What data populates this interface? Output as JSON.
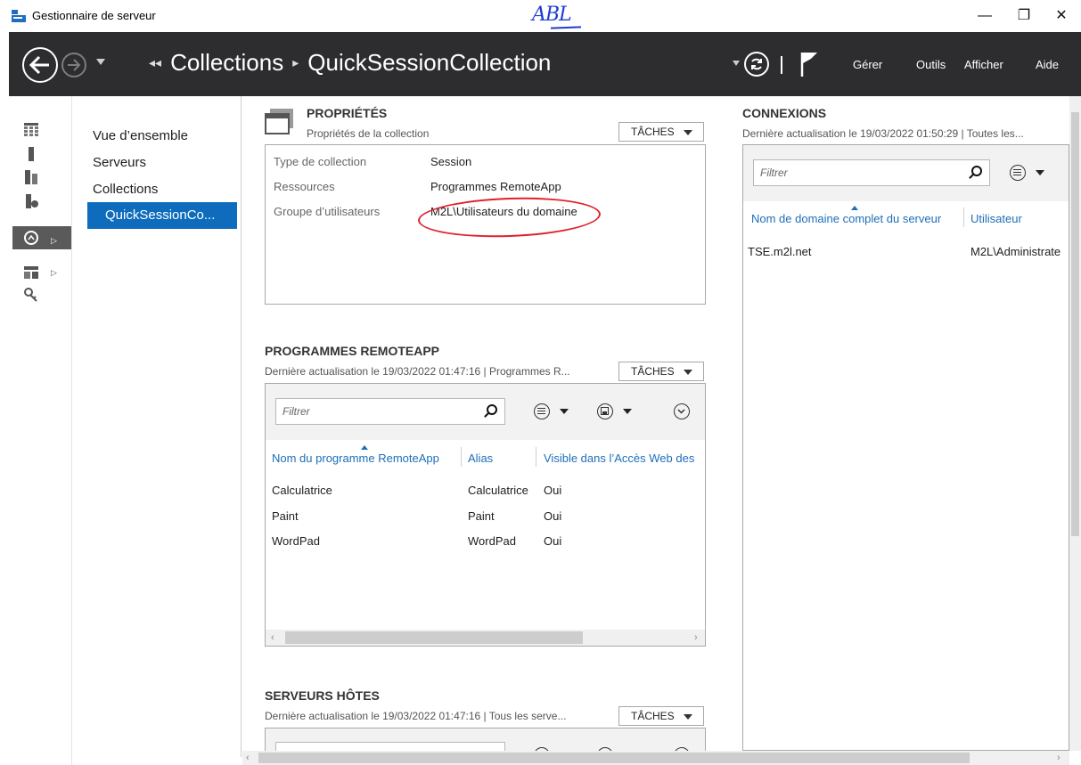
{
  "window": {
    "title": "Gestionnaire de serveur",
    "signature": "ABL",
    "minimize": "—",
    "restore": "❐",
    "close": "✕"
  },
  "nav": {
    "lead_marker": "◂◂",
    "breadcrumb": [
      "Collections",
      "QuickSessionCollection"
    ],
    "separator": "▸",
    "menu": [
      "Gérer",
      "Outils",
      "Afficher",
      "Aide"
    ]
  },
  "tree": {
    "items": [
      "Vue d’ensemble",
      "Serveurs",
      "Collections"
    ],
    "selected": "QuickSessionCo..."
  },
  "properties": {
    "title": "PROPRIÉTÉS",
    "subtitle": "Propriétés de la collection",
    "tasks": "TÂCHES",
    "rows": [
      {
        "label": "Type de collection",
        "value": "Session"
      },
      {
        "label": "Ressources",
        "value": "Programmes RemoteApp"
      },
      {
        "label": "Groupe d’utilisateurs",
        "value": "M2L\\Utilisateurs du domaine"
      }
    ]
  },
  "remoteapp": {
    "title": "PROGRAMMES REMOTEAPP",
    "subtitle": "Dernière actualisation le 19/03/2022 01:47:16 | Programmes R...",
    "tasks": "TÂCHES",
    "filter_placeholder": "Filtrer",
    "columns": [
      "Nom du programme RemoteApp",
      "Alias",
      "Visible dans l’Accès Web des"
    ],
    "rows": [
      [
        "Calculatrice",
        "Calculatrice",
        "Oui"
      ],
      [
        "Paint",
        "Paint",
        "Oui"
      ],
      [
        "WordPad",
        "WordPad",
        "Oui"
      ]
    ]
  },
  "hosts": {
    "title": "SERVEURS HÔTES",
    "subtitle": "Dernière actualisation le 19/03/2022 01:47:16 | Tous les serve...",
    "tasks": "TÂCHES"
  },
  "connections": {
    "title": "CONNEXIONS",
    "subtitle": "Dernière actualisation le 19/03/2022 01:50:29 | Toutes les...",
    "filter_placeholder": "Filtrer",
    "columns": [
      "Nom de domaine complet du serveur",
      "Utilisateur"
    ],
    "rows": [
      [
        "TSE.m2l.net",
        "M2L\\Administrate"
      ]
    ]
  },
  "colors": {
    "navbar": "#2d2d30",
    "selection": "#0f6cbd",
    "link": "#1d6fb8",
    "annotation": "#e0202a"
  }
}
